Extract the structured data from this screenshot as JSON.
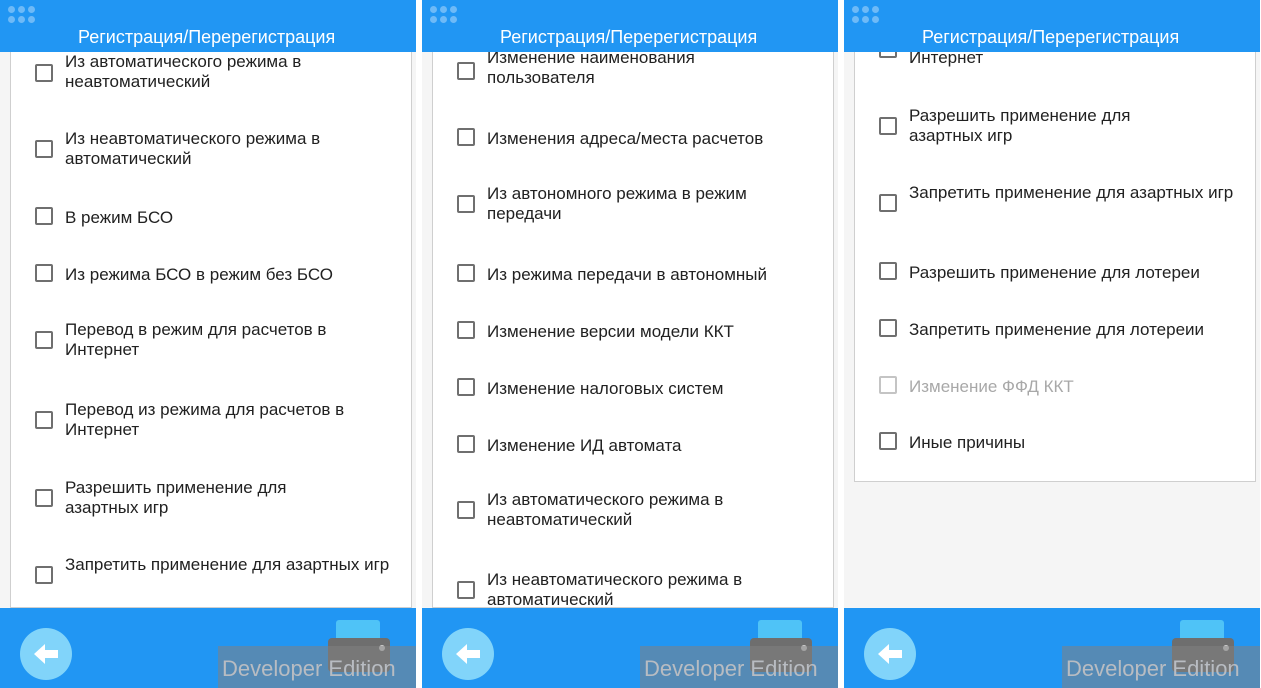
{
  "header": {
    "title": "Регистрация/Перерегистрация"
  },
  "panels": [
    {
      "items": [
        {
          "label": "Из автоматического режима в неавтоматический"
        },
        {
          "label": "Из неавтоматического режима в автоматический"
        },
        {
          "label": "В режим БСО"
        },
        {
          "label": "Из режима БСО в режим без БСО"
        },
        {
          "label": "Перевод в режим для расчетов в Интернет"
        },
        {
          "label": "Перевод из режима для расчетов в Интернет"
        },
        {
          "label": "Разрешить применение для азартных игр"
        },
        {
          "label": "Запретить применение для азартных игр"
        }
      ]
    },
    {
      "items": [
        {
          "label": "Изменение наименования пользователя"
        },
        {
          "label": "Изменения адреса/места расчетов"
        },
        {
          "label": "Из автономного режима в режим передачи"
        },
        {
          "label": "Из режима передачи в автономный"
        },
        {
          "label": "Изменение версии модели ККТ"
        },
        {
          "label": "Изменение налоговых систем"
        },
        {
          "label": "Изменение ИД автомата"
        },
        {
          "label": "Из автоматического режима в неавтоматический"
        },
        {
          "label": "Из неавтоматического режима в автоматический"
        }
      ]
    },
    {
      "items": [
        {
          "label": "Интернет"
        },
        {
          "label": "Разрешить применение для азартных игр"
        },
        {
          "label": "Запретить применение для азартных игр"
        },
        {
          "label": "Разрешить применение для лотереи"
        },
        {
          "label": "Запретить применение для лотереии"
        },
        {
          "label": "Изменение ФФД ККТ",
          "disabled": true
        },
        {
          "label": "Иные причины"
        }
      ]
    }
  ],
  "footer": {
    "back_icon": "arrow-left-icon",
    "print_icon": "printer-icon",
    "watermark": "Developer Edition"
  },
  "colors": {
    "primary": "#2196f3",
    "back_button": "#81d4fa",
    "checkbox_border": "#6f6f6f",
    "disabled_text": "#a8a8a8"
  }
}
